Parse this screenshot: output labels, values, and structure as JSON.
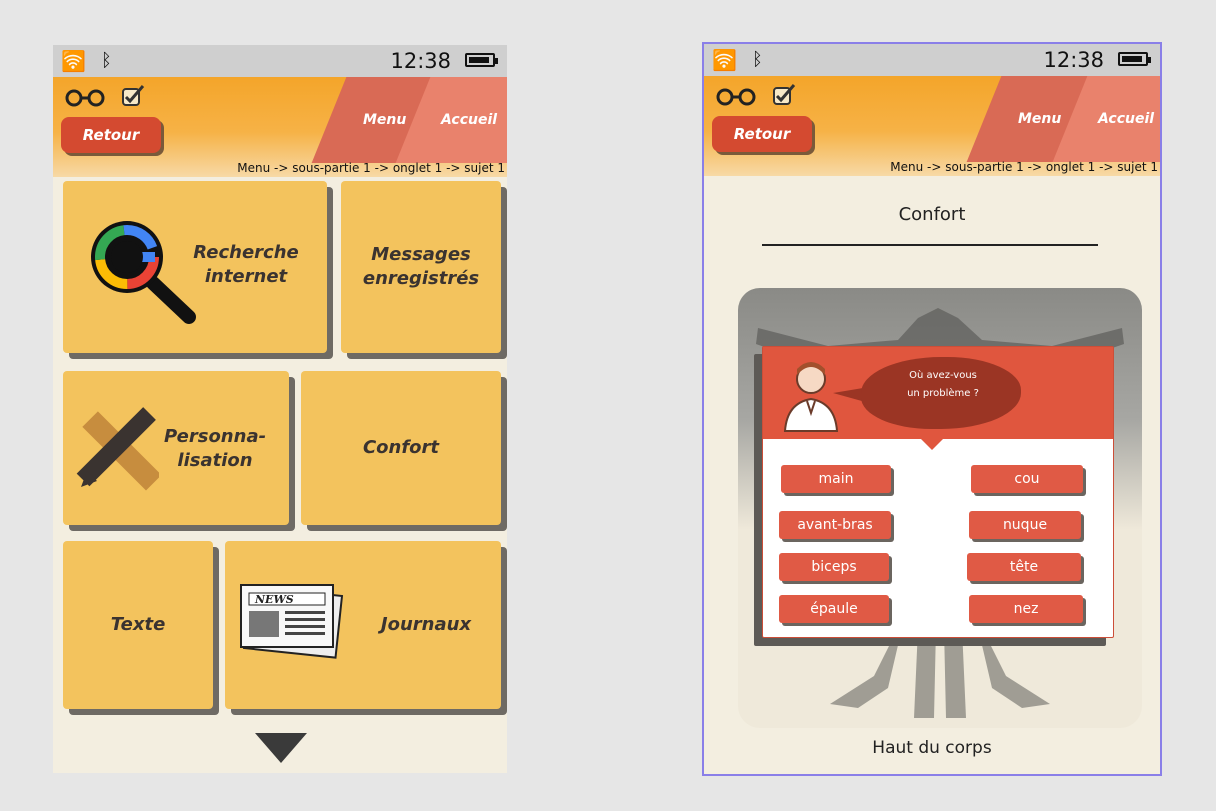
{
  "statusbar": {
    "time": "12:38"
  },
  "header": {
    "back_label": "Retour",
    "tab_menu": "Menu",
    "tab_accueil": "Accueil",
    "breadcrumb": "Menu -> sous-partie 1 -> onglet 1 -> sujet 1"
  },
  "left": {
    "tiles": [
      {
        "label": "Recherche\ninternet",
        "icon": "google-search-icon"
      },
      {
        "label": "Messages\nenregistrés"
      },
      {
        "label": "Personna-\nlisation",
        "icon": "pencil-ruler-icon"
      },
      {
        "label": "Confort"
      },
      {
        "label": "Texte"
      },
      {
        "label": "Journaux",
        "icon": "newspaper-icon"
      }
    ],
    "newspaper_headline": "NEWS"
  },
  "right": {
    "title": "Confort",
    "question": "Où avez-vous\nun problème ?",
    "options_left": [
      "main",
      "avant-bras",
      "biceps",
      "épaule"
    ],
    "options_right": [
      "cou",
      "nuque",
      "tête",
      "nez"
    ],
    "section": "Haut du corps"
  },
  "colors": {
    "header_orange": "#f4a52a",
    "tile_yellow": "#f3c35d",
    "button_red": "#d44a30",
    "chip_red": "#e05a45",
    "panel_red": "#e0563e",
    "bubble_dark": "#9b3524"
  }
}
